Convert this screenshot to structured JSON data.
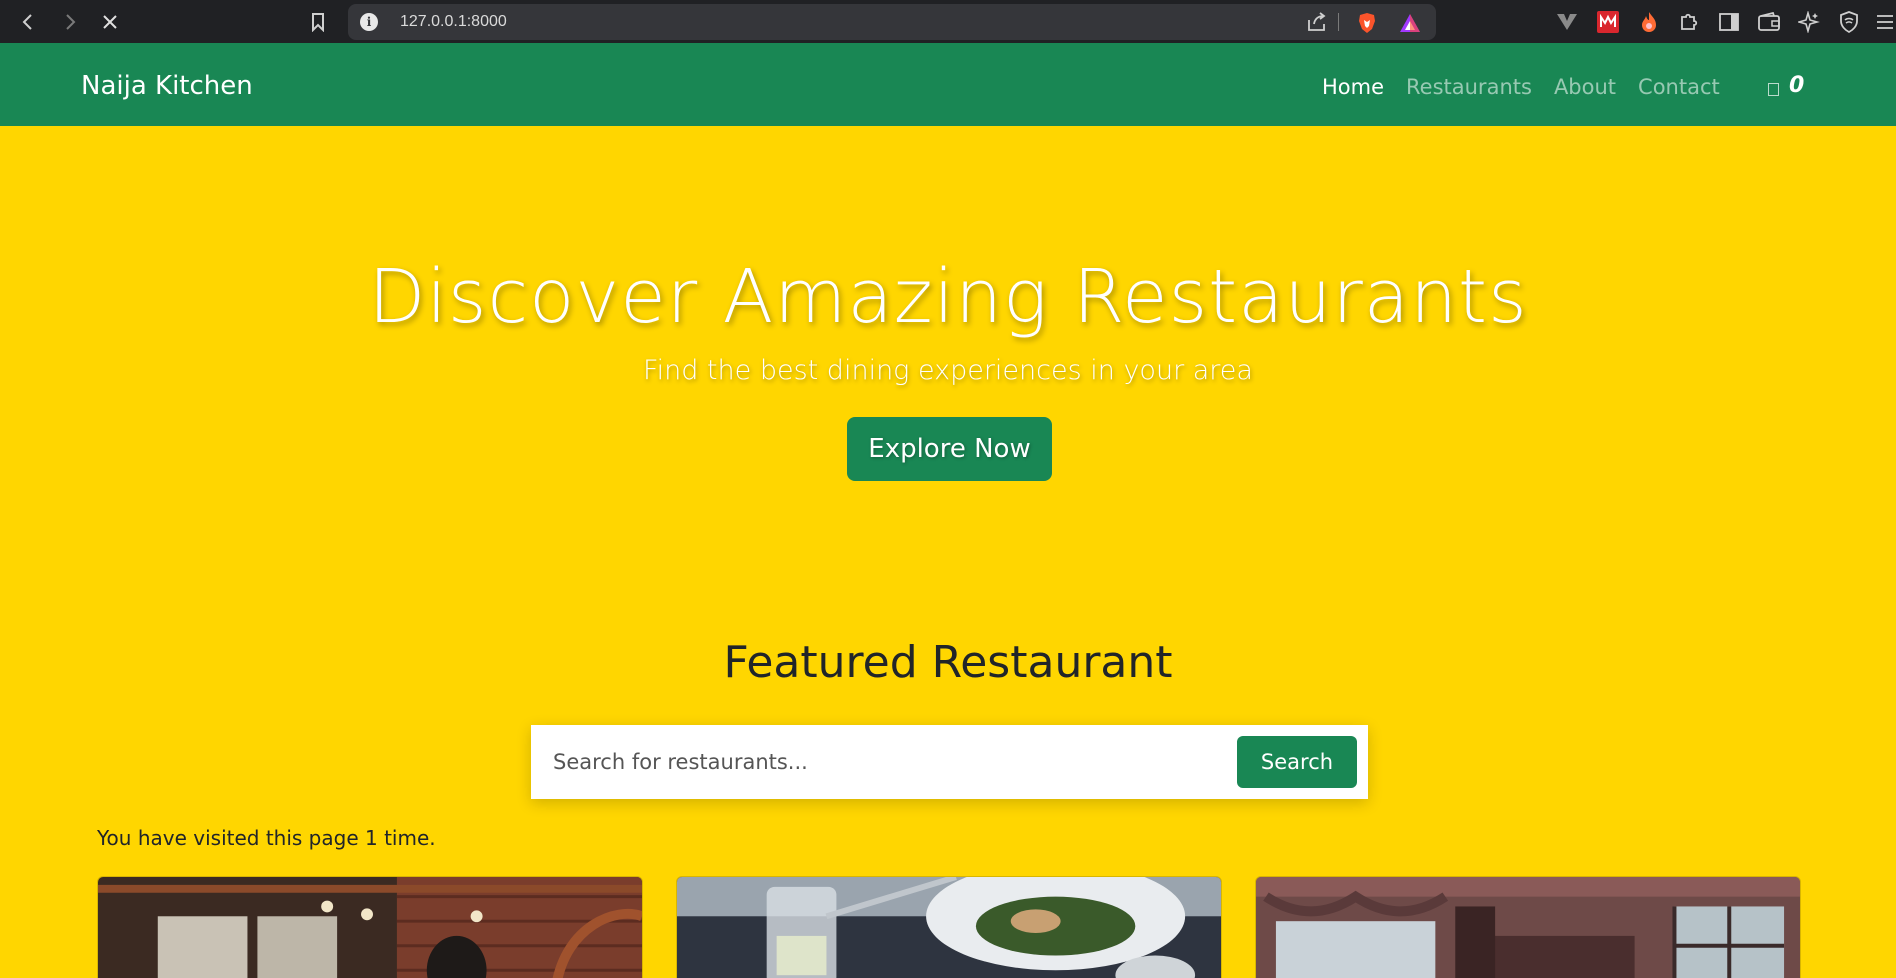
{
  "browser": {
    "url": "127.0.0.1:8000"
  },
  "navbar": {
    "brand": "Naija Kitchen",
    "links": [
      {
        "label": "Home",
        "active": true
      },
      {
        "label": "Restaurants",
        "active": false
      },
      {
        "label": "About",
        "active": false
      },
      {
        "label": "Contact",
        "active": false
      }
    ],
    "cart_count": "0",
    "cart_icon": "cart-icon"
  },
  "hero": {
    "title": "Discover Amazing Restaurants",
    "subtitle": "Find the best dining experiences in your area",
    "cta_label": "Explore Now"
  },
  "featured": {
    "heading": "Featured Restaurant",
    "search_placeholder": "Search for restaurants...",
    "search_value": "",
    "search_button_label": "Search",
    "visit_message": "You have visited this page 1 time."
  },
  "cards": [
    {
      "image": "restaurant-interior-brick-photo"
    },
    {
      "image": "food-plate-photo"
    },
    {
      "image": "restaurant-dining-room-photo"
    }
  ],
  "colors": {
    "brand_green": "#198754",
    "background_yellow": "#FFD600"
  }
}
